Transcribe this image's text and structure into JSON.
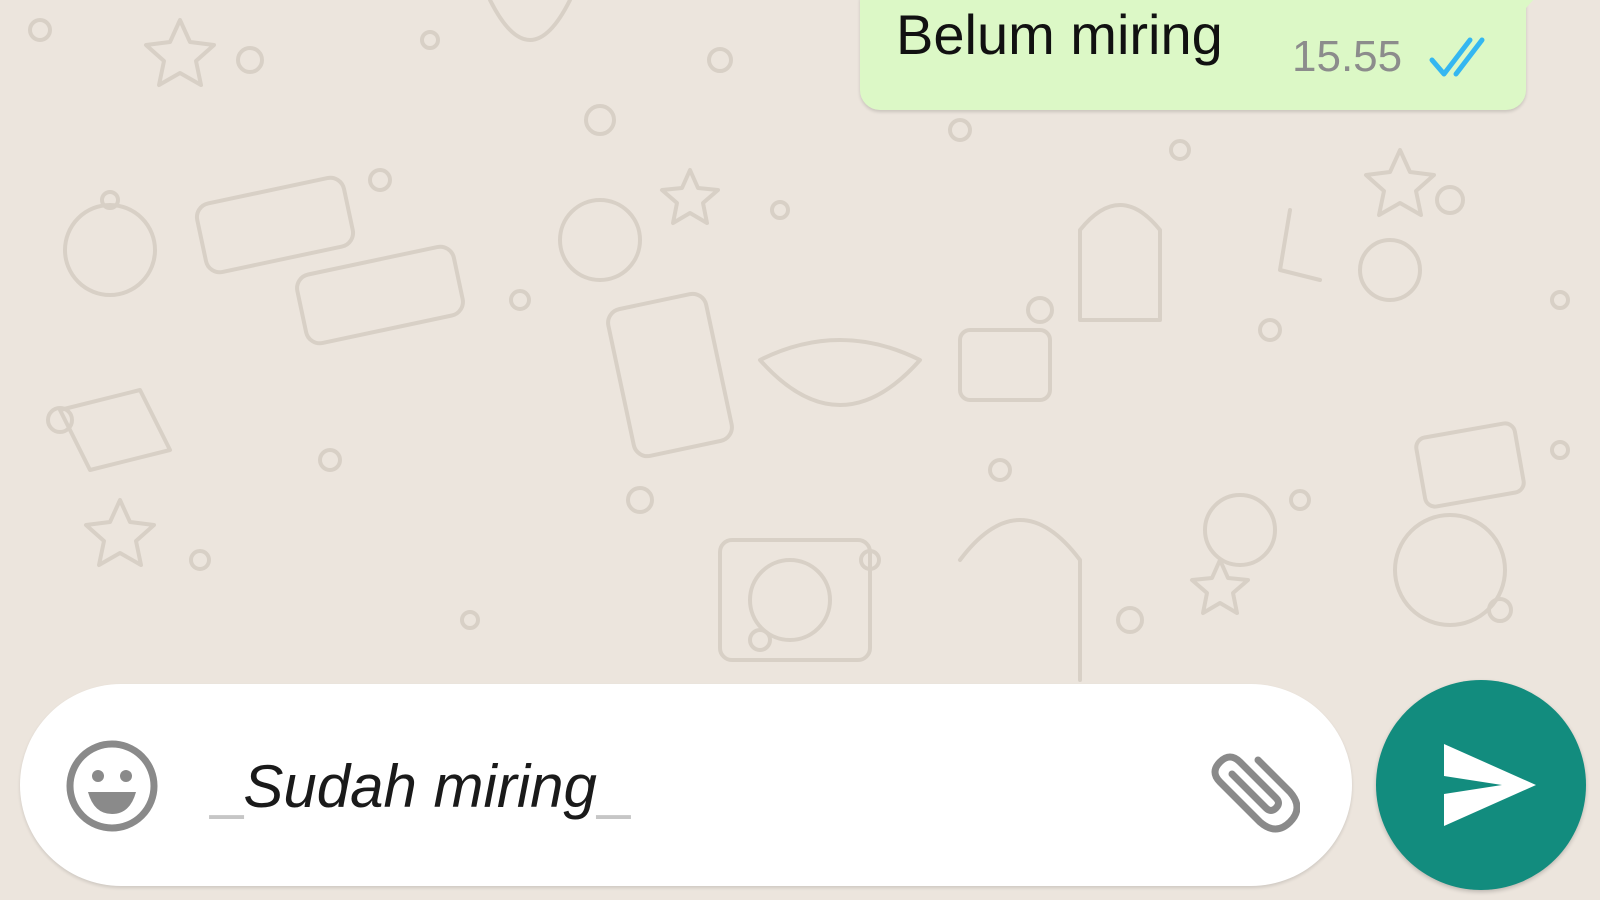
{
  "colors": {
    "wallpaper": "#ece5dd",
    "doodle": "#d8d0c6",
    "outgoing_bubble": "#dcf8c6",
    "read_ticks": "#34b7f1",
    "send_button": "#128c7e",
    "icon_grey": "#8a8a8a"
  },
  "conversation": {
    "messages": [
      {
        "direction": "outgoing",
        "text": "Belum miring",
        "time": "15.55",
        "status_icon": "double-check-read-icon"
      }
    ]
  },
  "composer": {
    "emoji_icon": "smiley-icon",
    "text_prefix": "_",
    "text_italic": "Sudah miring",
    "text_suffix": "_",
    "attach_icon": "paperclip-icon"
  },
  "send_button": {
    "icon": "send-arrow-icon"
  }
}
